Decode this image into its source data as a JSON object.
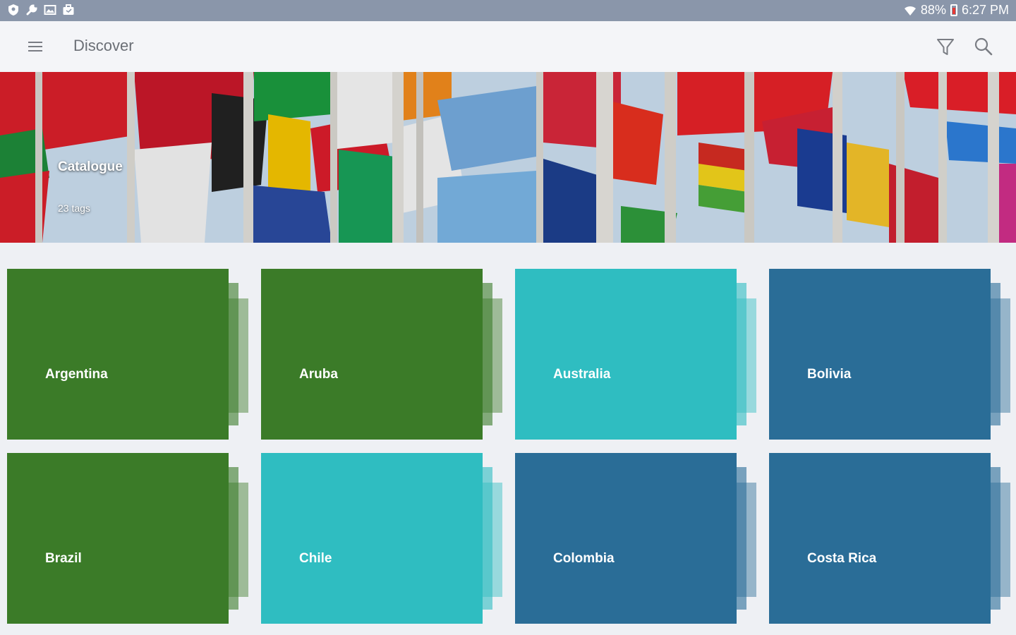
{
  "status_bar": {
    "battery": "88%",
    "time": "6:27 PM",
    "icons": [
      "shield-icon",
      "wrench-icon",
      "image-icon",
      "briefcase-icon",
      "wifi-icon",
      "battery-icon"
    ]
  },
  "toolbar": {
    "title": "Discover",
    "menu_icon": "hamburger-menu-icon",
    "filter_icon": "filter-icon",
    "search_icon": "search-icon"
  },
  "hero": {
    "title": "Catalogue",
    "subtitle": "23 tags"
  },
  "colors": {
    "green": "#3b7b28",
    "teal": "#2fbdc1",
    "blue": "#2a6d97",
    "status_bar": "#8a96aa",
    "toolbar": "#f4f5f8",
    "background": "#eef0f4"
  },
  "tiles": [
    {
      "label": "Argentina",
      "color": "#3b7b28"
    },
    {
      "label": "Aruba",
      "color": "#3b7b28"
    },
    {
      "label": "Australia",
      "color": "#2fbdc1"
    },
    {
      "label": "Bolivia",
      "color": "#2a6d97"
    },
    {
      "label": "Brazil",
      "color": "#3b7b28"
    },
    {
      "label": "Chile",
      "color": "#2fbdc1"
    },
    {
      "label": "Colombia",
      "color": "#2a6d97"
    },
    {
      "label": "Costa Rica",
      "color": "#2a6d97"
    }
  ]
}
